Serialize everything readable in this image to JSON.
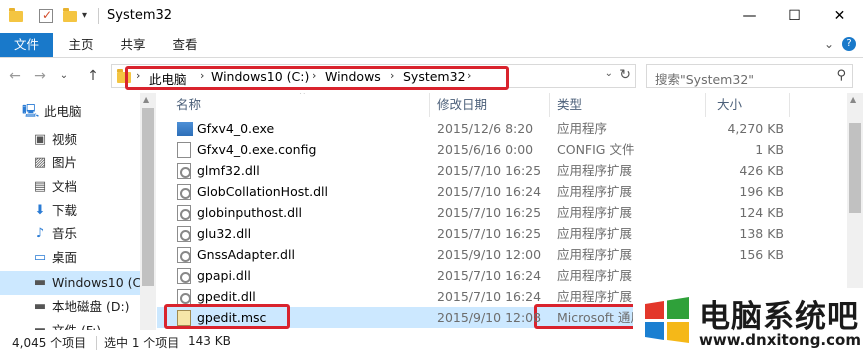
{
  "window": {
    "title": "System32",
    "minimize_glyph": "—",
    "maximize_glyph": "☐",
    "close_glyph": "✕",
    "qat_dropdown_glyph": "▾"
  },
  "ribbon": {
    "tabs": [
      "文件",
      "主页",
      "共享",
      "查看"
    ],
    "collapse_glyph": "⌄",
    "help_glyph": "?"
  },
  "address": {
    "back_glyph": "←",
    "forward_glyph": "→",
    "recent_glyph": "⌄",
    "up_glyph": "↑",
    "crumbs": [
      "此电脑",
      "Windows10 (C:)",
      "Windows",
      "System32"
    ],
    "crumb_arrow": "›",
    "dropdown_glyph": "⌄",
    "refresh_glyph": "↻",
    "search_placeholder": "搜索\"System32\"",
    "search_glyph": "⚲"
  },
  "nav": {
    "items": [
      {
        "label": "此电脑",
        "icon": "computer-icon",
        "glyph": "🖳"
      },
      {
        "label": "视频",
        "icon": "video-icon",
        "glyph": "▣"
      },
      {
        "label": "图片",
        "icon": "picture-icon",
        "glyph": "▨"
      },
      {
        "label": "文档",
        "icon": "document-icon",
        "glyph": "▤"
      },
      {
        "label": "下载",
        "icon": "download-icon",
        "glyph": "⬇"
      },
      {
        "label": "音乐",
        "icon": "music-icon",
        "glyph": "♪"
      },
      {
        "label": "桌面",
        "icon": "desktop-icon",
        "glyph": "▭"
      },
      {
        "label": "Windows10 (C:",
        "icon": "drive-icon",
        "glyph": "▬"
      },
      {
        "label": "本地磁盘 (D:)",
        "icon": "drive-icon",
        "glyph": "▬"
      },
      {
        "label": "文件 (F:)",
        "icon": "drive-icon",
        "glyph": "▬"
      }
    ]
  },
  "columns": {
    "name": "名称",
    "date": "修改日期",
    "type": "类型",
    "size": "大小",
    "sort_glyph": "^"
  },
  "files": [
    {
      "name": "Gfxv4_0.exe",
      "date": "2015/12/6 8:20",
      "type": "应用程序",
      "size": "4,270 KB",
      "icon": "exe"
    },
    {
      "name": "Gfxv4_0.exe.config",
      "date": "2015/6/16 0:00",
      "type": "CONFIG 文件",
      "size": "1 KB",
      "icon": "file"
    },
    {
      "name": "glmf32.dll",
      "date": "2015/7/10 16:25",
      "type": "应用程序扩展",
      "size": "426 KB",
      "icon": "dll"
    },
    {
      "name": "GlobCollationHost.dll",
      "date": "2015/7/10 16:24",
      "type": "应用程序扩展",
      "size": "196 KB",
      "icon": "dll"
    },
    {
      "name": "globinputhost.dll",
      "date": "2015/7/10 16:25",
      "type": "应用程序扩展",
      "size": "124 KB",
      "icon": "dll"
    },
    {
      "name": "glu32.dll",
      "date": "2015/7/10 16:25",
      "type": "应用程序扩展",
      "size": "138 KB",
      "icon": "dll"
    },
    {
      "name": "GnssAdapter.dll",
      "date": "2015/9/10 12:00",
      "type": "应用程序扩展",
      "size": "156 KB",
      "icon": "dll"
    },
    {
      "name": "gpapi.dll",
      "date": "2015/7/10 16:24",
      "type": "应用程序扩展",
      "size": "",
      "icon": "dll"
    },
    {
      "name": "gpedit.dll",
      "date": "2015/7/10 16:24",
      "type": "应用程序扩展",
      "size": "",
      "icon": "dll"
    },
    {
      "name": "gpedit.msc",
      "date": "2015/9/10 12:08",
      "type": "Microsoft 通用",
      "size": "",
      "icon": "msc"
    }
  ],
  "status": {
    "count": "4,045 个项目",
    "selected": "选中 1 个项目",
    "size": "143 KB"
  },
  "watermark": {
    "title": "电脑系统吧",
    "url": "www.dnxitong.com"
  },
  "colors": {
    "accent": "#1979ca",
    "selection": "#cce8ff",
    "highlight": "#d9232d"
  }
}
